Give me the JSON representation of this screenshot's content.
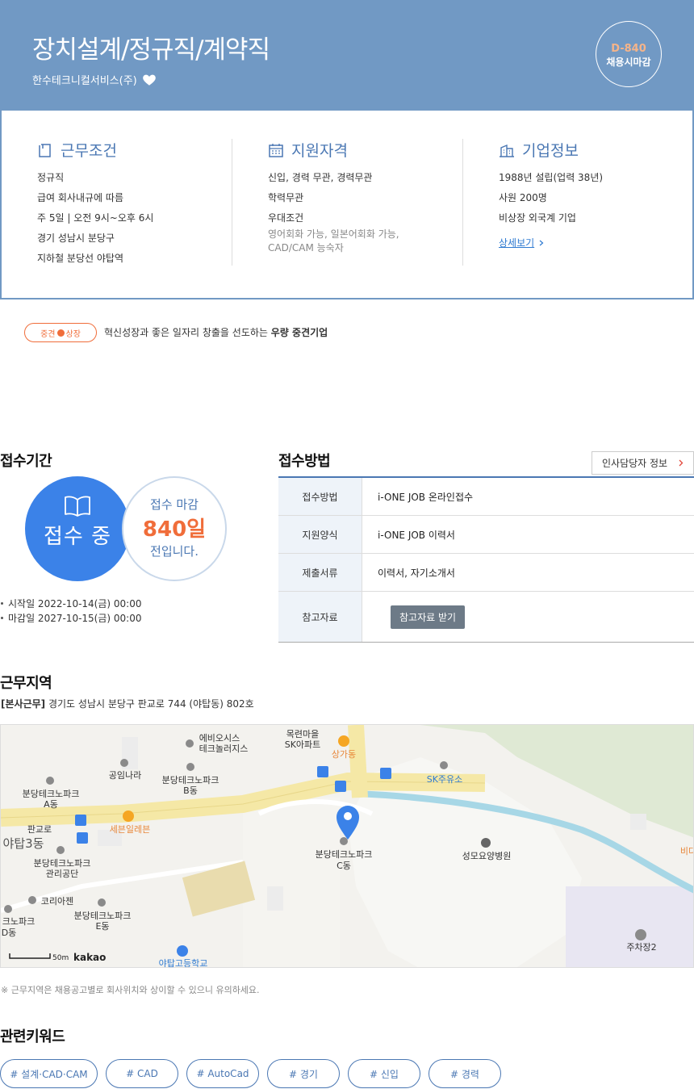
{
  "header": {
    "title": "장치설계/정규직/계약직",
    "company": "한수테크니컬서비스(주)",
    "dday": "D-840",
    "dday_label": "채용시마감"
  },
  "conditions": {
    "title": "근무조건",
    "items": [
      "정규직",
      "급여 회사내규에 따름",
      "주 5일 | 오전 9시~오후 6시",
      "경기 성남시 분당구",
      "지하철 분당선 야탑역"
    ]
  },
  "qualifications": {
    "title": "지원자격",
    "items": [
      "신입, 경력 무관, 경력무관",
      "학력무관",
      "우대조건"
    ],
    "preferred_detail": "영어회화 가능, 일본어회화 가능, CAD/CAM 능숙자"
  },
  "company_info": {
    "title": "기업정보",
    "items": [
      "1988년 설립(업력 38년)",
      "사원 200명",
      "비상장 외국계 기업"
    ],
    "detail_link": "상세보기"
  },
  "badge": {
    "label_a": "중견",
    "label_b": "상장",
    "desc_prefix": "혁신성장과 좋은 일자리 창출을 선도하는 ",
    "desc_bold": "우량 중견기업"
  },
  "period": {
    "title": "접수기간",
    "status": "접수 중",
    "deadline_line1": "접수 마감",
    "deadline_days": "840일",
    "deadline_line3": "전입니다.",
    "start": "시작일 2022-10-14(금) 00:00",
    "end": "마감일 2027-10-15(금) 00:00"
  },
  "apply": {
    "title": "접수방법",
    "hr_button": "인사담당자 정보",
    "rows": [
      {
        "label": "접수방법",
        "value": "i-ONE JOB 온라인접수"
      },
      {
        "label": "지원양식",
        "value": "i-ONE JOB 이력서"
      },
      {
        "label": "제출서류",
        "value": "이력서, 자기소개서"
      },
      {
        "label": "참고자료",
        "value": "참고자료 받기"
      }
    ]
  },
  "location": {
    "title": "근무지역",
    "tag": "[본사근무]",
    "address": "경기도 성남시 분당구 판교로 744 (야탑동) 802호",
    "note": "※ 근무지역은 채용공고별로 회사위치와 상이할 수 있으니 유의하세요.",
    "map_labels": {
      "apt": "목련마을 SK아파트",
      "apt_a": "목련마을",
      "apt_b": "SK아파트",
      "mall": "상가동",
      "ebi_a": "에비오시스",
      "ebi_b": "테크놀러지스",
      "gongim": "공임나라",
      "techb_a": "분당테크노파크",
      "techb_b": "B동",
      "techa_a": "분당테크노파크",
      "techa_b": "A동",
      "sk": "SK주유소",
      "pangyo": "판교로",
      "seven": "세븐일레븐",
      "yatap3": "야탑3동",
      "techc_a": "분당테크노파크",
      "techc_b": "C동",
      "hospital": "성모요양병원",
      "bida": "비다",
      "mgmt_a": "분당테크노파크",
      "mgmt_b": "관리공단",
      "korea": "코리아젠",
      "teche_a": "분당테크노파크",
      "teche_b": "E동",
      "techd_a": "크노파크",
      "techd_b": "D동",
      "school": "야탑고등학교",
      "parking": "주차장2",
      "scale": "50m",
      "brand": "kakao"
    }
  },
  "keywords": {
    "title": "관련키워드",
    "items": [
      "# 설계·CAD·CAM",
      "# CAD",
      "# AutoCad",
      "# 경기",
      "# 신입",
      "# 경력"
    ]
  },
  "colors": {
    "header_bg": "#7199c4",
    "accent_blue": "#4a77b3",
    "status_blue": "#3b82e8",
    "accent_orange": "#f06d3a"
  },
  "icons": [
    "heart-icon",
    "condition-icon",
    "calendar-icon",
    "building-icon",
    "chevron-right-icon",
    "book-icon",
    "map-pin-icon",
    "bus-stop-icon",
    "parking-icon"
  ]
}
